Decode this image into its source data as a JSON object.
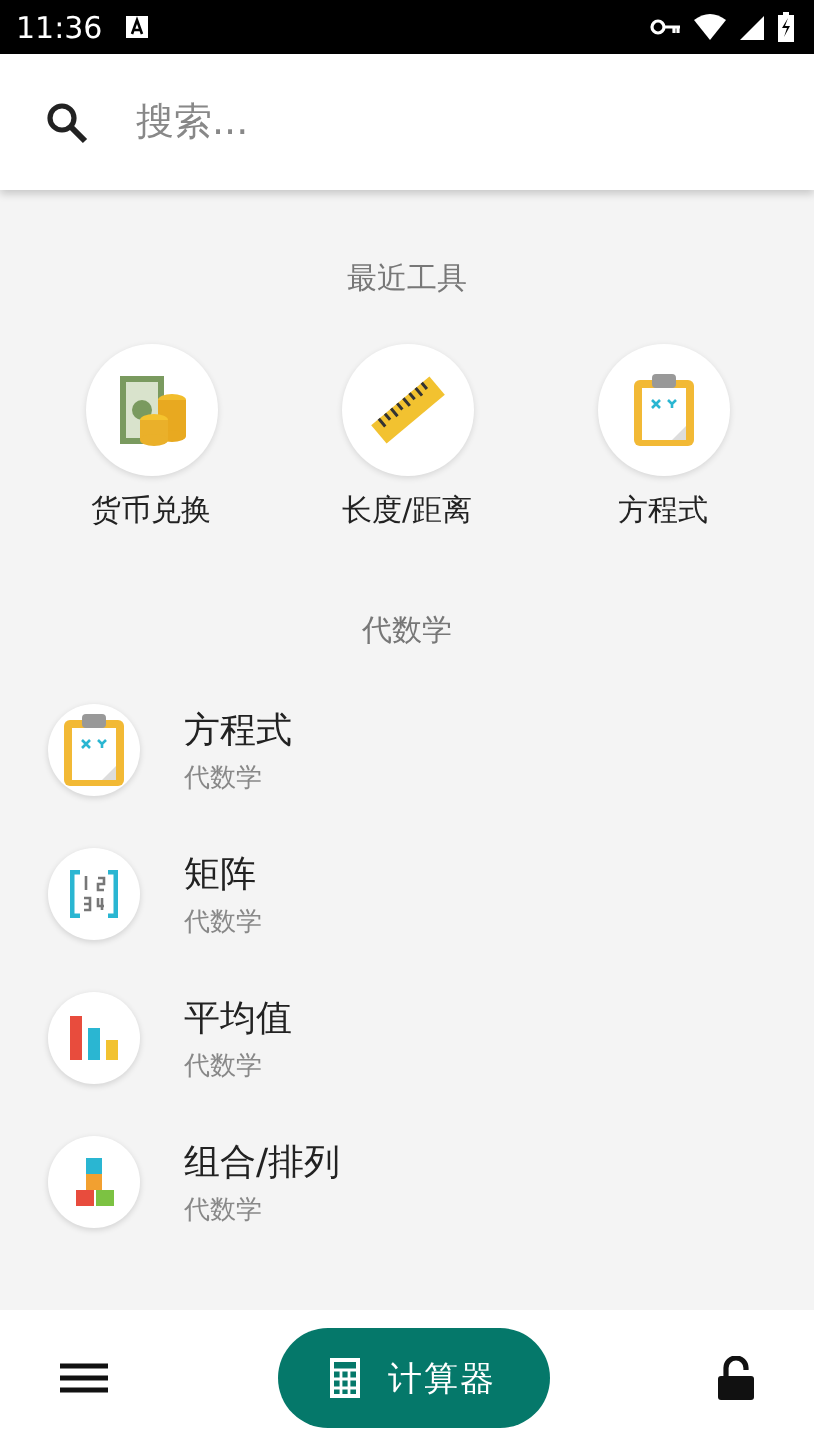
{
  "status_bar": {
    "time": "11:36"
  },
  "search": {
    "placeholder": "搜索..."
  },
  "recent": {
    "title": "最近工具",
    "items": [
      {
        "label": "货币兑换",
        "kind": "money"
      },
      {
        "label": "长度/距离",
        "kind": "ruler"
      },
      {
        "label": "方程式",
        "kind": "clipboard"
      }
    ]
  },
  "section": {
    "title": "代数学",
    "items": [
      {
        "title": "方程式",
        "subtitle": "代数学",
        "kind": "clipboard"
      },
      {
        "title": "矩阵",
        "subtitle": "代数学",
        "kind": "matrix"
      },
      {
        "title": "平均值",
        "subtitle": "代数学",
        "kind": "bars"
      },
      {
        "title": "组合/排列",
        "subtitle": "代数学",
        "kind": "blocks"
      }
    ]
  },
  "bottom_bar": {
    "button": "计算器"
  }
}
